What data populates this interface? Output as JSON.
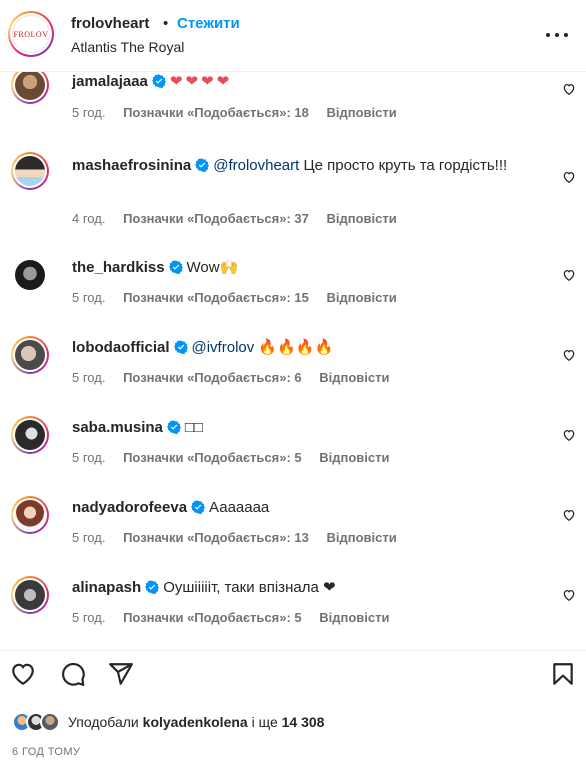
{
  "header": {
    "avatar_text": "FROLOV",
    "username": "frolovheart",
    "dot": "•",
    "follow_label": "Стежити",
    "location": "Atlantis The Royal",
    "more_icon": "more-horizontal-icon"
  },
  "colors": {
    "accent": "#0095f6",
    "mention": "#00376b",
    "meta_gray": "#737373",
    "text": "#262626",
    "heart_red": "#ed4956"
  },
  "comments": [
    {
      "username": "jamalajaaa",
      "verified": true,
      "mention": "",
      "text": "❤❤❤❤",
      "time": "5 год.",
      "likes": "Позначки «Подобається»: 18",
      "reply": "Відповісти"
    },
    {
      "username": "mashaefrosinina",
      "verified": true,
      "mention": "@frolovheart",
      "text": " Це просто круть та гордість!!!",
      "time": "4 год.",
      "likes": "Позначки «Подобається»: 37",
      "reply": "Відповісти"
    },
    {
      "username": "the_hardkiss",
      "verified": true,
      "mention": "",
      "text": "Wow🙌",
      "time": "5 год.",
      "likes": "Позначки «Подобається»: 15",
      "reply": "Відповісти"
    },
    {
      "username": "lobodaofficial",
      "verified": true,
      "mention": "@ivfrolov",
      "text": " 🔥🔥🔥🔥",
      "time": "5 год.",
      "likes": "Позначки «Подобається»: 6",
      "reply": "Відповісти"
    },
    {
      "username": "saba.musina",
      "verified": true,
      "mention": "",
      "text": "□□",
      "time": "5 год.",
      "likes": "Позначки «Подобається»: 5",
      "reply": "Відповісти"
    },
    {
      "username": "nadyadorofeeva",
      "verified": true,
      "mention": "",
      "text": "Ааааааа",
      "time": "5 год.",
      "likes": "Позначки «Подобається»: 13",
      "reply": "Відповісти"
    },
    {
      "username": "alinapash",
      "verified": true,
      "mention": "",
      "text": "Оушіііііт, таки впізнала ❤",
      "time": "5 год.",
      "likes": "Позначки «Подобається»: 5",
      "reply": "Відповісти"
    }
  ],
  "actions": {
    "like_icon": "heart-icon",
    "comment_icon": "comment-icon",
    "share_icon": "share-icon",
    "save_icon": "bookmark-icon"
  },
  "liked_by": {
    "prefix": "Уподобали",
    "user": "kolyadenkolena",
    "suffix": "і ще 14 308"
  },
  "time_ago": "6 ГОД ТОМУ"
}
